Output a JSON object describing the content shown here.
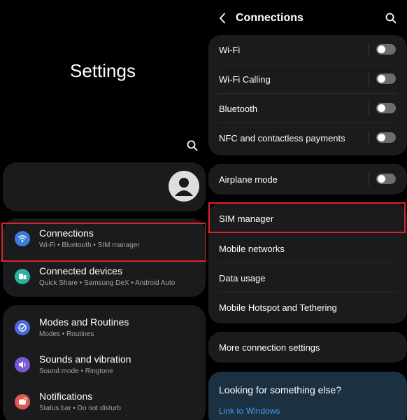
{
  "left": {
    "title": "Settings",
    "items": [
      {
        "label": "Connections",
        "subtitle": "Wi-Fi  •  Bluetooth  •  SIM manager",
        "icon": "wifi-icon",
        "icon_color": "#3b7ddd"
      },
      {
        "label": "Connected devices",
        "subtitle": "Quick Share  •  Samsung DeX  •  Android Auto",
        "icon": "devices-icon",
        "icon_color": "#2bb3a0"
      },
      {
        "label": "Modes and Routines",
        "subtitle": "Modes  •  Routines",
        "icon": "check-circle-icon",
        "icon_color": "#4c68d7"
      },
      {
        "label": "Sounds and vibration",
        "subtitle": "Sound mode  •  Ringtone",
        "icon": "volume-icon",
        "icon_color": "#7b5ad6"
      },
      {
        "label": "Notifications",
        "subtitle": "Status bar  •  Do not disturb",
        "icon": "notification-icon",
        "icon_color": "#e0584f"
      }
    ]
  },
  "right": {
    "title": "Connections",
    "toggles": [
      {
        "label": "Wi-Fi",
        "enabled": false
      },
      {
        "label": "Wi-Fi Calling",
        "enabled": false
      },
      {
        "label": "Bluetooth",
        "enabled": false
      },
      {
        "label": "NFC and contactless payments",
        "enabled": false
      }
    ],
    "airplane": {
      "label": "Airplane mode",
      "enabled": false
    },
    "list": [
      {
        "label": "SIM manager"
      },
      {
        "label": "Mobile networks"
      },
      {
        "label": "Data usage"
      },
      {
        "label": "Mobile Hotspot and Tethering"
      }
    ],
    "more": {
      "label": "More connection settings"
    },
    "looking": {
      "question": "Looking for something else?",
      "link": "Link to Windows"
    }
  },
  "colors": {
    "highlight": "#d9262d",
    "link": "#4a9de8",
    "card": "#1b1b1d"
  }
}
